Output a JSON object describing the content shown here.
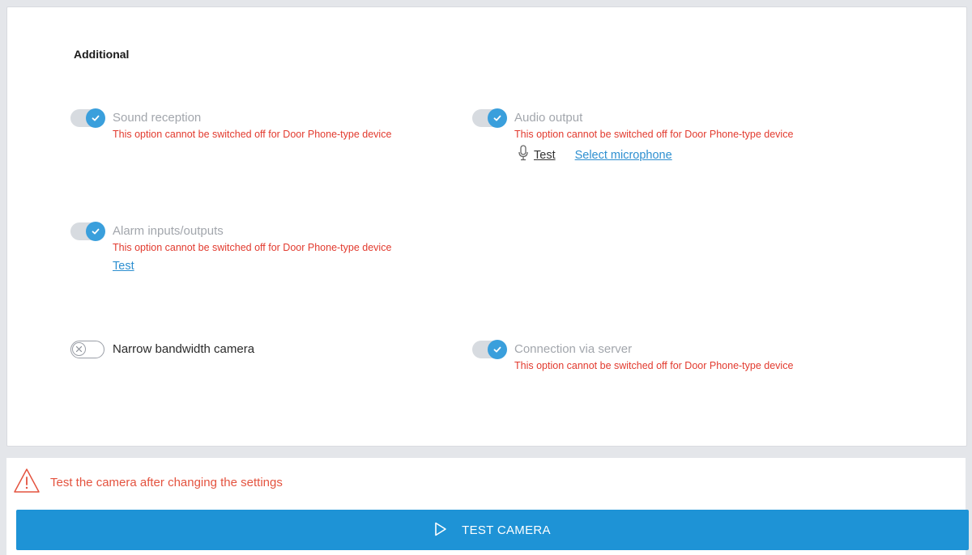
{
  "section": {
    "title": "Additional"
  },
  "options": {
    "sound_reception": {
      "label": "Sound reception",
      "checked": true,
      "disabled": true,
      "warning": "This option cannot be switched off for Door Phone-type device"
    },
    "audio_output": {
      "label": "Audio output",
      "checked": true,
      "disabled": true,
      "warning": "This option cannot be switched off for Door Phone-type device",
      "test_label": "Test",
      "select_microphone_label": "Select microphone",
      "icon": "microphone-icon"
    },
    "alarm_io": {
      "label": "Alarm inputs/outputs",
      "checked": true,
      "disabled": true,
      "warning": "This option cannot be switched off for Door Phone-type device",
      "test_label": "Test"
    },
    "narrow_bandwidth": {
      "label": "Narrow bandwidth camera",
      "checked": false,
      "disabled": false
    },
    "connection_via_server": {
      "label": "Connection via server",
      "checked": true,
      "disabled": true,
      "warning": "This option cannot be switched off for Door Phone-type device"
    }
  },
  "footer": {
    "warning_text": "Test the camera after changing the settings",
    "warning_icon": "warning-triangle-icon",
    "test_button_label": "TEST CAMERA",
    "test_button_icon": "play-icon"
  },
  "colors": {
    "accent": "#1e93d6",
    "toggle_on": "#3a9fdc",
    "warning": "#e23a2e",
    "link": "#2d8fd0"
  }
}
